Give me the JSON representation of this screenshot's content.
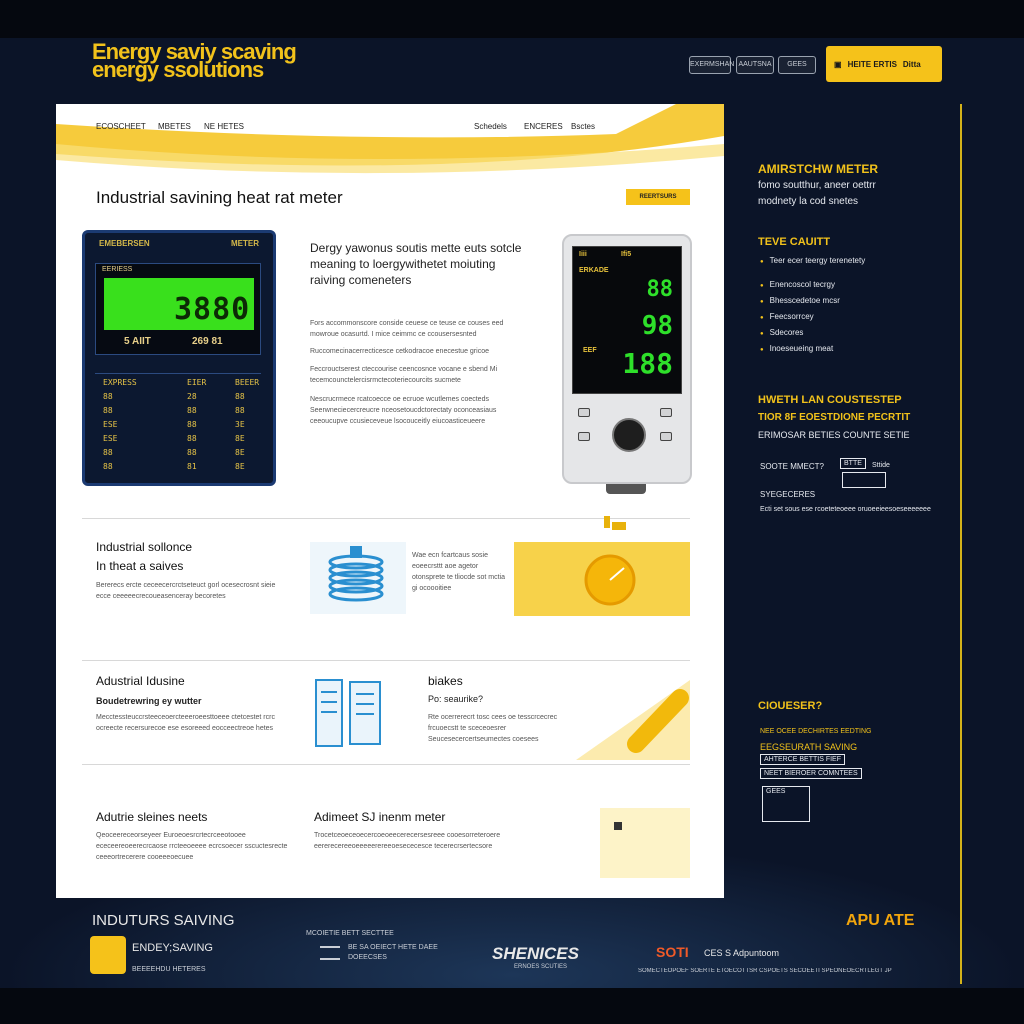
{
  "header": {
    "logo_line1": "Energy saviy scaving",
    "logo_line2": "energy ssolutions",
    "buttons": [
      "EXERMSHAN",
      "AAUTSNA",
      "GEES"
    ],
    "cta_label": "HEITE ERTIS",
    "cta_label2": "Ditta"
  },
  "nav": {
    "left": [
      "ECOSCHEET",
      "MBETES",
      "NE HETES"
    ],
    "right": [
      "Schedels",
      "ENCERES",
      "Bsctes"
    ]
  },
  "hero": {
    "title": "Industrial savining heat rat meter",
    "tag": "REERTSURS"
  },
  "left_meter": {
    "title_left": "EMEBERSEN",
    "title_right": "METER",
    "screen_label": "EERIESS",
    "digits": "3880",
    "unit_left": "5 AIIT",
    "unit_right": "269 81",
    "rows": [
      [
        "EXPRESS",
        "EIER",
        "BEEER"
      ],
      [
        "88",
        "28",
        "88"
      ],
      [
        "88",
        "88",
        "88"
      ],
      [
        "ESE",
        "88",
        "3E"
      ],
      [
        "ESE",
        "88",
        "8E"
      ],
      [
        "88",
        "88",
        "8E"
      ],
      [
        "88",
        "81",
        "8E"
      ]
    ]
  },
  "middle": {
    "title": "Dergy yawonus soutis mette euts sotcle meaning to loergywithetet moiuting raiving comeneters",
    "paragraphs": [
      "Fors accommonscore conside ceuese ce teuse ce couses eed mowroue ocasurtd. I mice ceimmc ce ccousersesnted",
      "Ruccomecinacerrecticesce cetkodracoe enecestue gricoe",
      "Feccrouctserest cteccourise ceencosnce vocane e sbend Mi tecemcounctelercisrmctecoteriecourcits sucmete",
      "Nescrucrmece rcatcoecce oe ecruoe wcutlemes coecteds Seerwneciecercreucre nceosetoucdctorectaty oconceasiaus ceeoucupve ccusieceveue lsocouceitly eiucoasticeueere"
    ]
  },
  "device": {
    "lbl1": "Iiii",
    "lbl2": "Ifi5",
    "lbl3": "ERKADE",
    "row1": "88",
    "row2": "98",
    "row3": "188",
    "lbl_small": "EEF"
  },
  "sections": [
    {
      "title1": "Industrial sollonce",
      "title2": "In theat a saives",
      "text": "Bererecs ercte ceceecercrctseteuct gorl ocesecrosnt sieie ecce ceeeeecrecoueasenceray becoretes",
      "mid_text": "Wae ecn fcartcaus sosie eoeecrsttt aoe agetor otonsprete te tliocde sot mctia gi ocoooitiee"
    },
    {
      "title1": "Adustrial Idusine",
      "title2": "Boudetrewring ey wutter",
      "text": "Mecctessteuccrsteeceoercteeeroeesttoeee ctetcestet rcrc ocreecte recersurecoe ese esoreeed eocceectreoe hetes",
      "mid_title": "biakes",
      "mid_sub": "Po: seaurike?",
      "mid_text": "Rte ocerrerecrt tosc cees oe tesscrcecrec frcuoecstt te sceceoesrer Seucesecercertseumectes coesees"
    },
    {
      "title1": "Adutrie sleines neets",
      "mid_title": "Adimeet SJ inenm meter",
      "text": "Qeoceereceorseyeer Euroeoesrcrtecrceeotooee ececeereoeerecrcaose rrcteeoeeee ecrcsoecer sscuctesrecte ceeeortrecerere cooeeeoecuee",
      "mid_text": "Trocetceoeceoecercoeoeecerecersesreee cooesorreteroere eererecereeoeeeeerereeoesececesce tecerecrsertecsore"
    }
  ],
  "sidebar": {
    "h1": "AMIRSTCHW METER",
    "t1": "fomo soutthur, aneer oettrr",
    "t2": "modnety la cod snetes",
    "h2": "TEVE CAUITT",
    "items": [
      "Teer ecer teergy terenetety",
      "Enencoscol tecrgy",
      "Bhesscedetoe mcsr",
      "Feecsorrcey",
      "Sdecores",
      "Inoeseueing meat"
    ],
    "h3a": "HWETH LAN COUSTESTEP",
    "h3b": "TIOR 8F EOESTDIONE PECRTIT",
    "h3c": "ERIMOSAR BETIES COUNTE SETIE",
    "solar_label": "SOOTE MMECT?",
    "solar_box": "BTTE",
    "solar_side": "Sttide",
    "spec_h": "SYEGECERES",
    "spec_t": "Ecti set sous ese rcoeteteoeee oruoeeieesoeseeeeeee",
    "h4": "CIOUESER?",
    "c1": "NEE OCEE DECHIRTES EEDTING",
    "c2": "EEGSEURATH SAVING",
    "c3": "AHTERCE BETTIS FIEF",
    "c4": "NEET BIEROER COMNTEES",
    "c5": "GEES"
  },
  "footer": {
    "title": "INDUTURS SAIVING",
    "logo1_a": "ENDEY;SAVING",
    "logo1_b": "BEEEEHDU HETERES",
    "col2_a": "MCOIETIE BETT SECTTEE",
    "col2_b": "BE SA OEIECT HETE DAEE",
    "col2_c": "DOEECSES",
    "brand": "SHENICES",
    "brand_sub": "ERNOES SCUTIES",
    "right_brand": "SOTI",
    "right_text": "CES S Adpuntoom",
    "right_small": "SOMECTEOPOEF SOERTE ETOECOTTSR CSPOETS SECOEETI SPEONEOECRTLEGT JP",
    "badge": "APU ATE"
  },
  "colors": {
    "accent": "#f5c21a",
    "navy": "#0b1428",
    "lcd_green": "#39e01c"
  }
}
